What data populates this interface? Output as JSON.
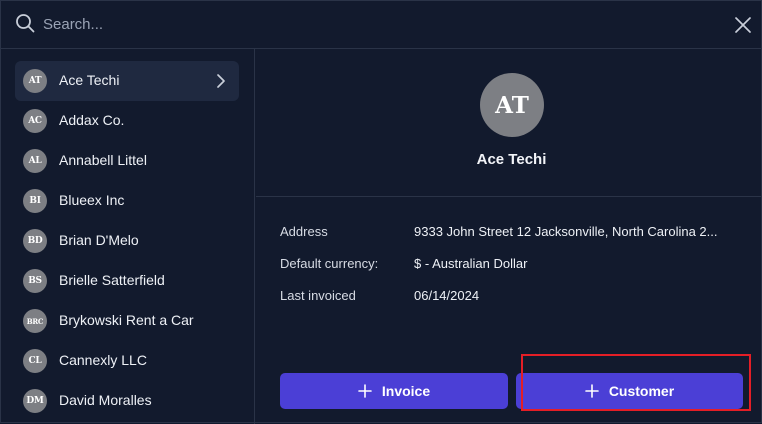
{
  "search": {
    "placeholder": "Search..."
  },
  "customers": [
    {
      "initials": "AT",
      "name": "Ace Techi",
      "selected": true
    },
    {
      "initials": "AC",
      "name": "Addax Co."
    },
    {
      "initials": "AL",
      "name": "Annabell Littel"
    },
    {
      "initials": "BI",
      "name": "Blueex Inc"
    },
    {
      "initials": "BD",
      "name": "Brian D'Melo"
    },
    {
      "initials": "BS",
      "name": "Brielle Satterfield"
    },
    {
      "initials": "BRC",
      "name": "Brykowski Rent a Car"
    },
    {
      "initials": "CL",
      "name": "Cannexly LLC"
    },
    {
      "initials": "DM",
      "name": "David Moralles"
    }
  ],
  "detail": {
    "initials": "AT",
    "name": "Ace Techi",
    "fields": [
      {
        "label": "Address",
        "value": "9333 John Street 12 Jacksonville, North Carolina 2..."
      },
      {
        "label": "Default currency:",
        "value": "$ - Australian Dollar"
      },
      {
        "label": "Last invoiced",
        "value": "06/14/2024"
      }
    ]
  },
  "buttons": {
    "invoice_label": "Invoice",
    "customer_label": "Customer"
  },
  "colors": {
    "background": "#121a2d",
    "selected_row": "#1f2940",
    "avatar": "#7d7f84",
    "button": "#4b3fd6",
    "highlight": "#e41e26"
  },
  "icons": {
    "search": "search-icon",
    "close": "close-icon",
    "chevron": "chevron-right-icon",
    "plus": "plus-icon"
  }
}
